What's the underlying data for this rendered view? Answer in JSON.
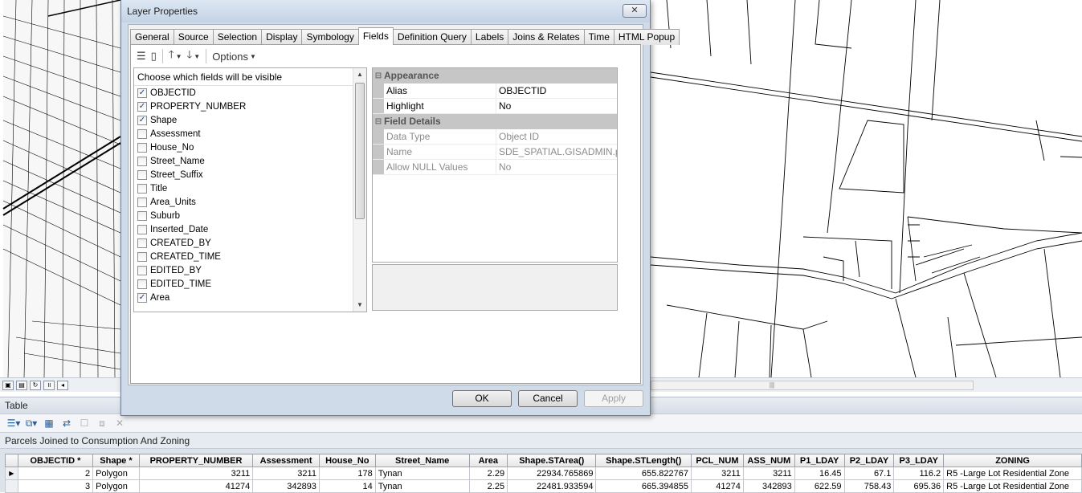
{
  "dialog": {
    "title": "Layer Properties",
    "close_label": "✕",
    "tabs": [
      "General",
      "Source",
      "Selection",
      "Display",
      "Symbology",
      "Fields",
      "Definition Query",
      "Labels",
      "Joins & Relates",
      "Time",
      "HTML Popup"
    ],
    "active_tab": "Fields",
    "options_label": "Options",
    "field_list_header": "Choose which fields will be visible",
    "fields": [
      {
        "name": "OBJECTID",
        "checked": true
      },
      {
        "name": "PROPERTY_NUMBER",
        "checked": true
      },
      {
        "name": "Shape",
        "checked": true
      },
      {
        "name": "Assessment",
        "checked": false
      },
      {
        "name": "House_No",
        "checked": false
      },
      {
        "name": "Street_Name",
        "checked": false
      },
      {
        "name": "Street_Suffix",
        "checked": false
      },
      {
        "name": "Title",
        "checked": false
      },
      {
        "name": "Area_Units",
        "checked": false
      },
      {
        "name": "Suburb",
        "checked": false
      },
      {
        "name": "Inserted_Date",
        "checked": false
      },
      {
        "name": "CREATED_BY",
        "checked": false
      },
      {
        "name": "CREATED_TIME",
        "checked": false
      },
      {
        "name": "EDITED_BY",
        "checked": false
      },
      {
        "name": "EDITED_TIME",
        "checked": false
      },
      {
        "name": "Area",
        "checked": true
      }
    ],
    "properties": {
      "appearance_label": "Appearance",
      "alias_key": "Alias",
      "alias_value": "OBJECTID",
      "highlight_key": "Highlight",
      "highlight_value": "No",
      "details_label": "Field Details",
      "datatype_key": "Data Type",
      "datatype_value": "Object ID",
      "name_key": "Name",
      "name_value": "SDE_SPATIAL.GISADMIN.pro",
      "nulls_key": "Allow NULL Values",
      "nulls_value": "No"
    },
    "buttons": {
      "ok": "OK",
      "cancel": "Cancel",
      "apply": "Apply"
    }
  },
  "table": {
    "window_title": "Table",
    "layer_title": "Parcels Joined to Consumption And Zoning",
    "columns": [
      "OBJECTID *",
      "Shape *",
      "PROPERTY_NUMBER",
      "Assessment",
      "House_No",
      "Street_Name",
      "Area",
      "Shape.STArea()",
      "Shape.STLength()",
      "PCL_NUM",
      "ASS_NUM",
      "P1_LDAY",
      "P2_LDAY",
      "P3_LDAY",
      "ZONING"
    ],
    "rows": [
      {
        "selector": "▶",
        "cells": [
          "2",
          "Polygon",
          "3211",
          "3211",
          "178",
          "Tynan",
          "2.29",
          "22934.765869",
          "655.822767",
          "3211",
          "3211",
          "16.45",
          "67.1",
          "116.2",
          "R5 -Large Lot Residential Zone"
        ]
      },
      {
        "selector": "▶",
        "cells": [
          "3",
          "Polygon",
          "41274",
          "342893",
          "14",
          "Tynan",
          "2.25",
          "22481.933594",
          "665.394855",
          "41274",
          "342893",
          "622.59",
          "758.43",
          "695.36",
          "R5 -Large Lot Residential Zone"
        ]
      }
    ]
  },
  "icons": [
    "list-view-icon",
    "move-up-icon",
    "move-down-icon",
    "close-icon",
    "table-options-icon",
    "related-tables-icon"
  ]
}
